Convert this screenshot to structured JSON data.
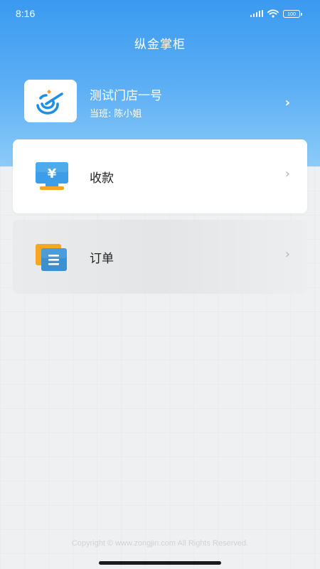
{
  "status_bar": {
    "time": "8:16",
    "battery": "100"
  },
  "header": {
    "title": "纵金掌柜"
  },
  "store": {
    "name": "测试门店一号",
    "shift_label": "当班:",
    "shift_person": "陈小姐",
    "arrow": "›"
  },
  "menu": [
    {
      "label": "收款",
      "icon": "payment-icon",
      "arrow": "›"
    },
    {
      "label": "订单",
      "icon": "order-icon",
      "arrow": "›"
    }
  ],
  "footer": {
    "copyright": "Copyright © www.zongjin.com All Rights Reserved."
  },
  "colors": {
    "header_top": "#3a9af0",
    "header_bottom": "#8ccbf8",
    "background": "#eef0f1"
  }
}
